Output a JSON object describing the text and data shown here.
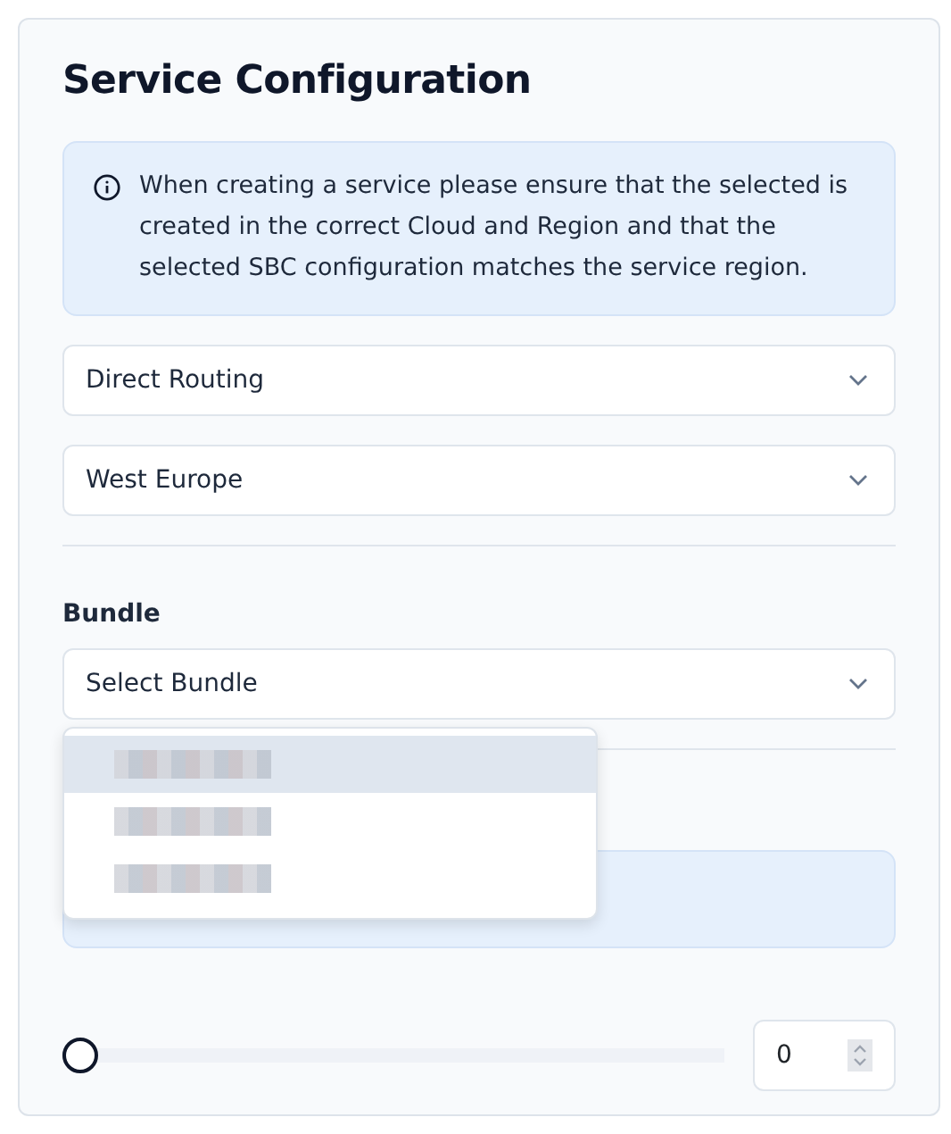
{
  "title": "Service Configuration",
  "notice": {
    "text": "When creating a service please ensure that the selected is created in the correct Cloud and Region and that the selected SBC configuration matches the service region."
  },
  "selects": [
    {
      "value": "Direct Routing"
    },
    {
      "value": "West Europe"
    }
  ],
  "bundle": {
    "label": "Bundle",
    "value": "Select Bundle",
    "expanded": true,
    "options": [
      {
        "kind": "redacted",
        "selected": true
      },
      {
        "kind": "redacted",
        "selected": false
      },
      {
        "kind": "redacted",
        "selected": false
      }
    ]
  },
  "quantity": {
    "level": 0,
    "value": "0"
  }
}
